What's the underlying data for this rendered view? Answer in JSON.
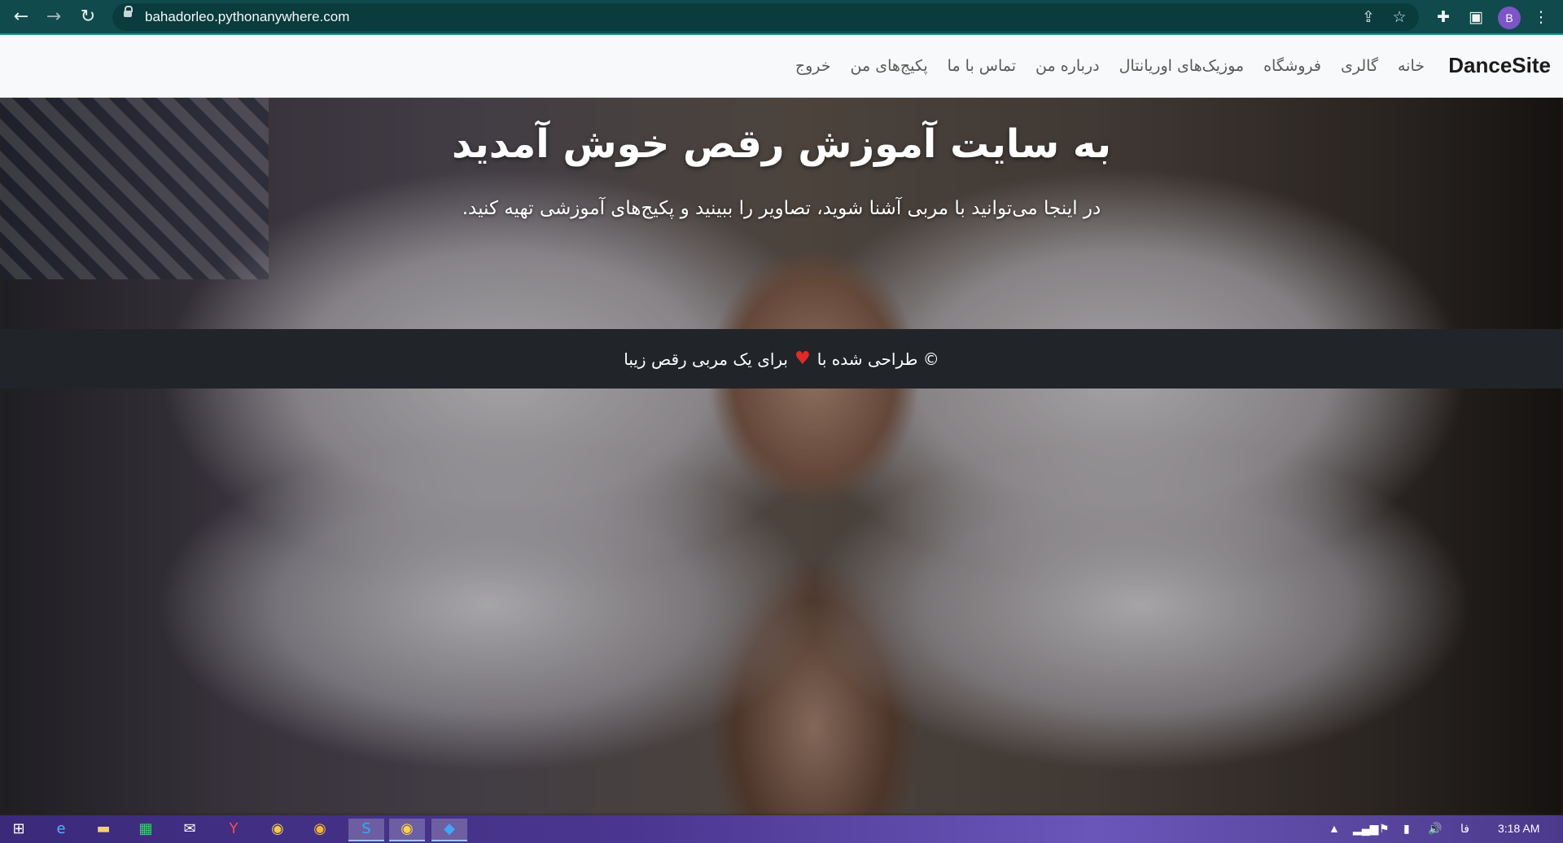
{
  "browser": {
    "url": "bahadorleo.pythonanywhere.com",
    "profile_initial": "B",
    "icons": [
      "back-icon",
      "forward-icon",
      "reload-icon",
      "lock-icon",
      "share-icon",
      "star-icon",
      "extensions-icon",
      "sidepanel-icon",
      "menu-icon"
    ]
  },
  "navbar": {
    "brand": "DanceSite",
    "items": [
      {
        "label": "خانه"
      },
      {
        "label": "گالری"
      },
      {
        "label": "فروشگاه"
      },
      {
        "label": "موزیک‌های اوریانتال"
      },
      {
        "label": "درباره من"
      },
      {
        "label": "تماس با ما"
      },
      {
        "label": "پکیج‌های من"
      },
      {
        "label": "خروج"
      }
    ]
  },
  "hero": {
    "title": "به سایت آموزش رقص خوش آمدید",
    "subtitle": "در اینجا می‌توانید با مربی آشنا شوید، تصاویر را ببینید و پکیج‌های آموزشی تهیه کنید."
  },
  "footer": {
    "prefix": "© طراحی شده با",
    "heart": "♥",
    "suffix": "برای یک مربی رقص زیبا"
  },
  "taskbar": {
    "language": "فا",
    "time": "3:18 AM",
    "apps": [
      "windows-icon",
      "edge-icon",
      "file-explorer-icon",
      "store-icon",
      "mail-icon",
      "yandex-icon",
      "chrome-icon",
      "chrome-canary-icon",
      "skype-icon",
      "chrome-active-icon",
      "vscode-icon"
    ]
  }
}
